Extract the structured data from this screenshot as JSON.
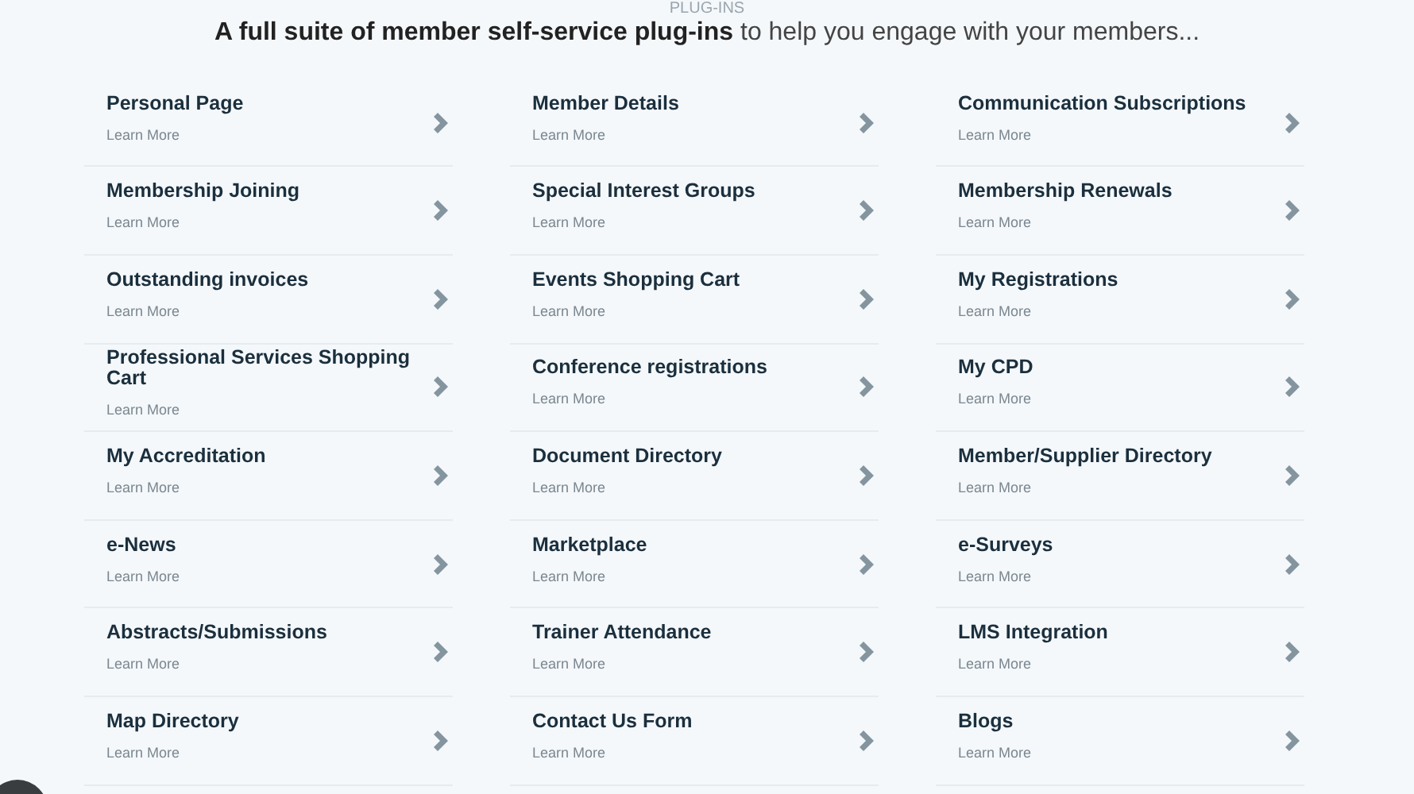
{
  "section_label": "PLUG-INS",
  "headline": "**A full suite of member self-service plug-ins** to help you engage with your members...",
  "columns": [
    {
      "items": [
        {
          "title": "Personal Page",
          "link": "Learn More"
        },
        {
          "title": "Membership Joining",
          "link": "Learn More"
        },
        {
          "title": "Outstanding invoices",
          "link": "Learn More"
        },
        {
          "title": "Professional Services Shopping Cart",
          "link": "Learn More"
        },
        {
          "title": "My Accreditation",
          "link": "Learn More"
        },
        {
          "title": "e-News",
          "link": "Learn More"
        },
        {
          "title": "Abstracts/Submissions",
          "link": "Learn More"
        },
        {
          "title": "Map Directory",
          "link": "Learn More"
        }
      ]
    },
    {
      "items": [
        {
          "title": "Member Details",
          "link": "Learn More"
        },
        {
          "title": "Special Interest Groups",
          "link": "Learn More"
        },
        {
          "title": "Events Shopping Cart",
          "link": "Learn More"
        },
        {
          "title": "Conference registrations",
          "link": "Learn More"
        },
        {
          "title": "Document Directory",
          "link": "Learn More"
        },
        {
          "title": "Marketplace",
          "link": "Learn More"
        },
        {
          "title": "Trainer Attendance",
          "link": "Learn More"
        },
        {
          "title": "Contact Us Form",
          "link": "Learn More"
        }
      ]
    },
    {
      "items": [
        {
          "title": "Communication Subscriptions",
          "link": "Learn More"
        },
        {
          "title": "Membership Renewals",
          "link": "Learn More"
        },
        {
          "title": "My Registrations",
          "link": "Learn More"
        },
        {
          "title": "My CPD",
          "link": "Learn More"
        },
        {
          "title": "Member/Supplier Directory",
          "link": "Learn More"
        },
        {
          "title": "e-Surveys",
          "link": "Learn More"
        },
        {
          "title": "LMS Integration",
          "link": "Learn More"
        },
        {
          "title": "Blogs",
          "link": "Learn More"
        }
      ]
    }
  ]
}
